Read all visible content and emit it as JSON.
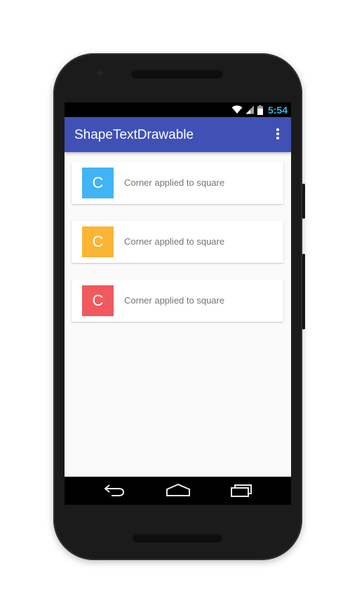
{
  "status_bar": {
    "time": "5:54"
  },
  "app_bar": {
    "title": "ShapeTextDrawable"
  },
  "cards": [
    {
      "letter": "C",
      "text": "Corner applied to square",
      "color": "#40b4f5"
    },
    {
      "letter": "C",
      "text": "Corner applied to square",
      "color": "#fbb535"
    },
    {
      "letter": "C",
      "text": "Corner applied to square",
      "color": "#f05a5e"
    }
  ],
  "colors": {
    "primary": "#3f51b5",
    "status_accent": "#33b5e5"
  },
  "icons": [
    "wifi-icon",
    "cell-signal-icon",
    "battery-icon",
    "overflow-menu-icon",
    "back-icon",
    "home-icon",
    "recents-icon"
  ]
}
